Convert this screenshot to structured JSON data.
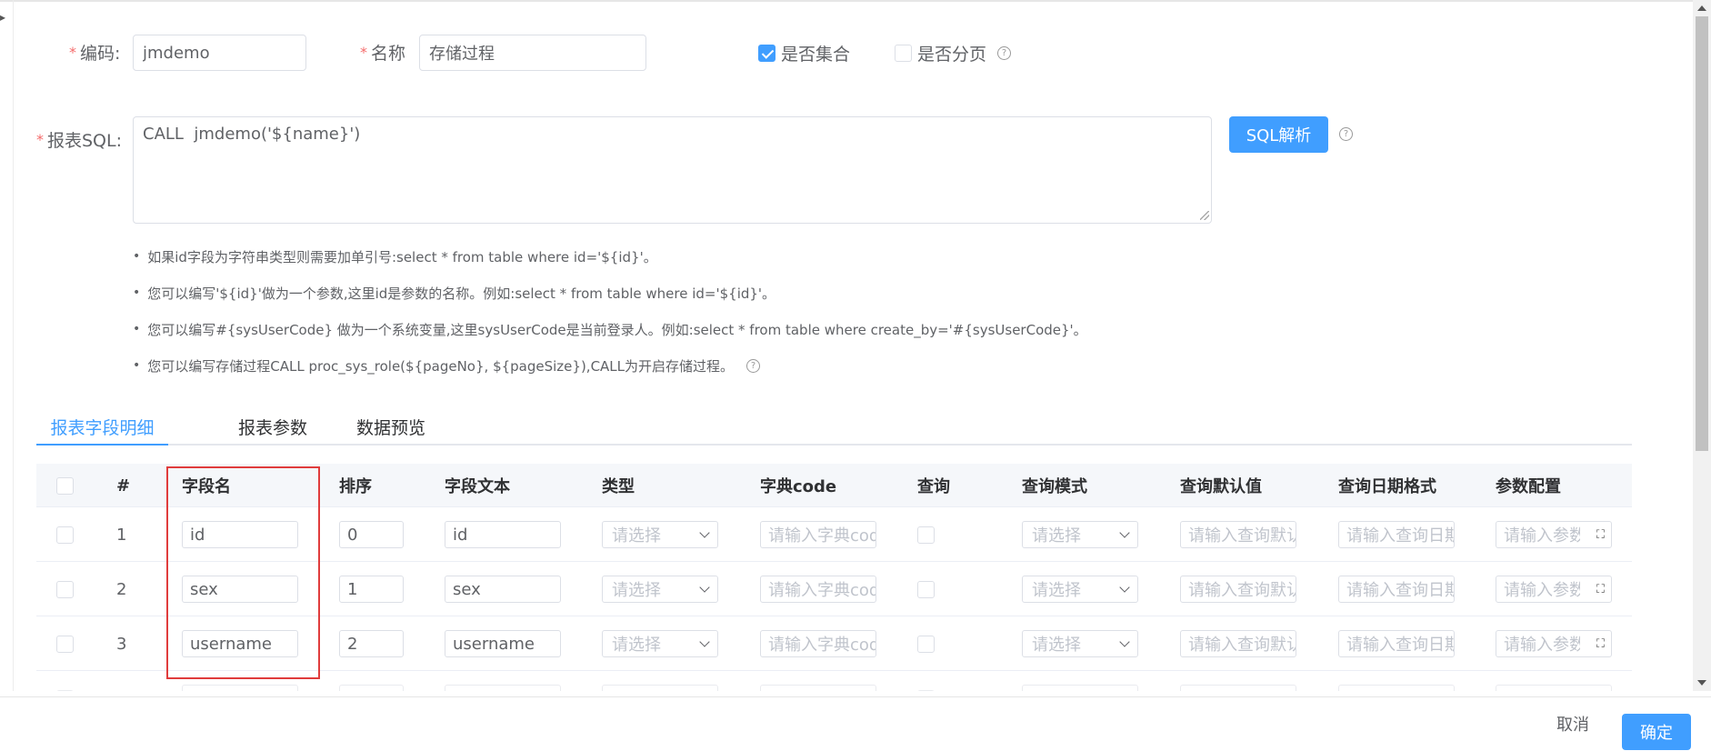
{
  "form": {
    "code_label": "编码:",
    "code_value": "jmdemo",
    "name_label": "名称",
    "name_value": "存储过程",
    "is_collection_label": "是否集合",
    "is_paged_label": "是否分页",
    "sql_label": "报表SQL:",
    "sql_value": "CALL  jmdemo('${name}')",
    "parse_button": "SQL解析",
    "required_mark": "*"
  },
  "tips": [
    "如果id字段为字符串类型则需要加单引号:select * from table where id='${id}'。",
    "您可以编写'${id}'做为一个参数,这里id是参数的名称。例如:select * from table where id='${id}'。",
    "您可以编写#{sysUserCode} 做为一个系统变量,这里sysUserCode是当前登录人。例如:select * from table where create_by='#{sysUserCode}'。",
    "您可以编写存储过程CALL proc_sys_role(${pageNo}, ${pageSize}),CALL为开启存储过程。"
  ],
  "tabs": [
    "报表字段明细",
    "报表参数",
    "数据预览"
  ],
  "table": {
    "headers": [
      "#",
      "字段名",
      "排序",
      "字段文本",
      "类型",
      "字典code",
      "查询",
      "查询模式",
      "查询默认值",
      "查询日期格式",
      "参数配置"
    ],
    "placeholders": {
      "type": "请选择",
      "dict_code": "请输入字典code",
      "query_mode": "请选择",
      "default_value": "请输入查询默认值",
      "date_format": "请输入查询日期格式",
      "param_config": "请输入参数配置"
    },
    "rows": [
      {
        "index": "1",
        "field": "id",
        "order": "0",
        "text": "id"
      },
      {
        "index": "2",
        "field": "sex",
        "order": "1",
        "text": "sex"
      },
      {
        "index": "3",
        "field": "username",
        "order": "2",
        "text": "username"
      }
    ]
  },
  "footer": {
    "cancel": "取消",
    "confirm": "确定"
  },
  "colors": {
    "primary": "#409eff",
    "required": "#f56c6c",
    "highlight": "#e03c3c"
  }
}
